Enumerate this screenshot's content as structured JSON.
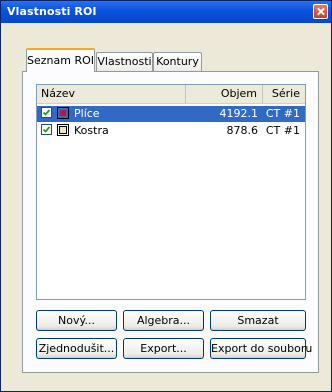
{
  "window": {
    "title": "Vlastnosti ROI"
  },
  "tabs": [
    {
      "label": "Seznam ROI",
      "active": true
    },
    {
      "label": "Vlastnosti",
      "active": false
    },
    {
      "label": "Kontury",
      "active": false
    }
  ],
  "roi_list": {
    "columns": [
      "Název",
      "Objem (ccm)",
      "Série"
    ],
    "rows": [
      {
        "checked": true,
        "color": "#c0143c",
        "name": "Plíce",
        "volume": "4192.1",
        "series": "CT #1",
        "selected": true
      },
      {
        "checked": true,
        "color": "#f2e6b4",
        "name": "Kostra",
        "volume": "878.6",
        "series": "CT #1",
        "selected": false
      }
    ]
  },
  "buttons": {
    "new": "Nový...",
    "algebra": "Algebra...",
    "delete": "Smazat",
    "simplify": "Zjednodušit...",
    "export": "Export...",
    "export_file": "Export do souboru"
  },
  "colors": {
    "titlebar": "#0a52dc",
    "selection": "#316ac5",
    "active_tab_accent": "#f6a923"
  }
}
